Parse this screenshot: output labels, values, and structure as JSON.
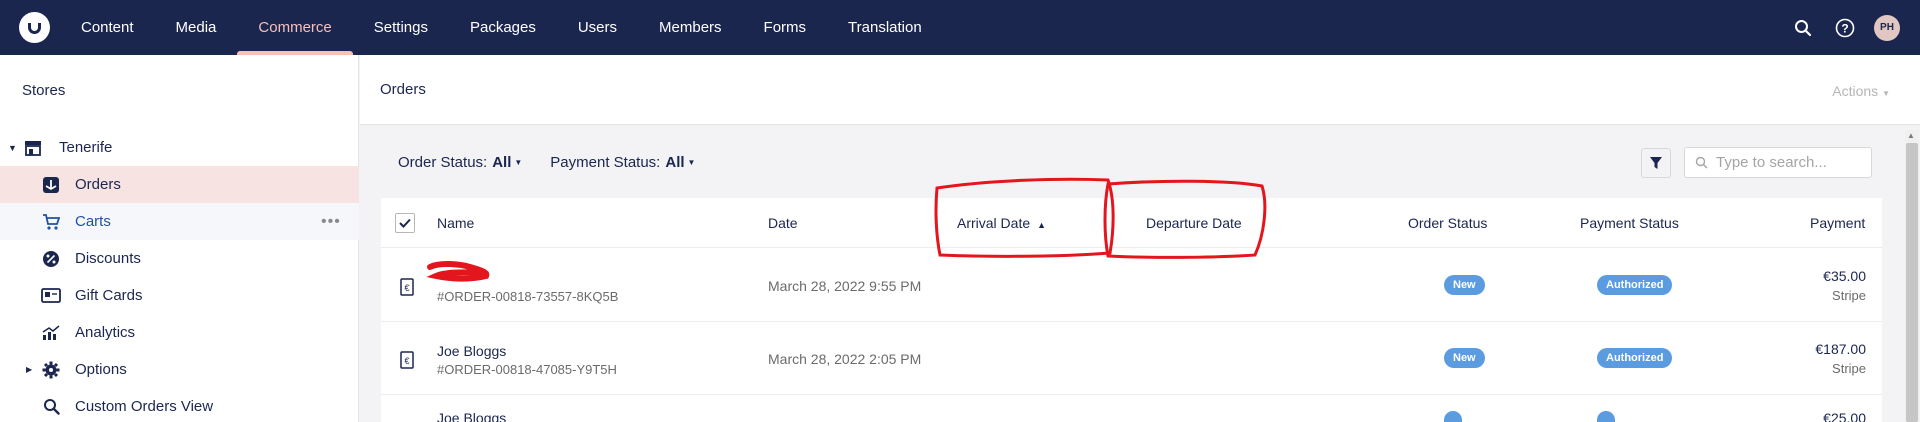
{
  "topbar": {
    "nav": [
      {
        "label": "Content",
        "active": false
      },
      {
        "label": "Media",
        "active": false
      },
      {
        "label": "Commerce",
        "active": true
      },
      {
        "label": "Settings",
        "active": false
      },
      {
        "label": "Packages",
        "active": false
      },
      {
        "label": "Users",
        "active": false
      },
      {
        "label": "Members",
        "active": false
      },
      {
        "label": "Forms",
        "active": false
      },
      {
        "label": "Translation",
        "active": false
      }
    ],
    "user_initials": "PH",
    "icons": [
      "search-icon",
      "help-icon",
      "avatar"
    ]
  },
  "sidebar": {
    "title": "Stores",
    "store": "Tenerife",
    "items": [
      {
        "label": "Orders",
        "icon": "orders-icon",
        "state": "active"
      },
      {
        "label": "Carts",
        "icon": "cart-icon",
        "state": "hover"
      },
      {
        "label": "Discounts",
        "icon": "discount-icon",
        "state": ""
      },
      {
        "label": "Gift Cards",
        "icon": "gift-card-icon",
        "state": ""
      },
      {
        "label": "Analytics",
        "icon": "analytics-icon",
        "state": ""
      },
      {
        "label": "Options",
        "icon": "gear-icon",
        "state": ""
      },
      {
        "label": "Custom Orders View",
        "icon": "search-icon",
        "state": ""
      }
    ],
    "more_label": "•••"
  },
  "main": {
    "title": "Orders",
    "actions_label": "Actions",
    "filters": {
      "order_status_label": "Order Status:",
      "order_status_value": "All",
      "payment_status_label": "Payment Status:",
      "payment_status_value": "All"
    },
    "search_placeholder": "Type to search...",
    "columns": {
      "name": "Name",
      "date": "Date",
      "arrival": "Arrival Date",
      "departure": "Departure Date",
      "order_status": "Order Status",
      "payment_status": "Payment Status",
      "payment": "Payment"
    },
    "rows": [
      {
        "name": "",
        "order": "#ORDER-00818-73557-8KQ5B",
        "date": "March 28, 2022 9:55 PM",
        "order_status": "New",
        "payment_status": "Authorized",
        "amount": "€35.00",
        "gateway": "Stripe"
      },
      {
        "name": "Joe Bloggs",
        "order": "#ORDER-00818-47085-Y9T5H",
        "date": "March 28, 2022 2:05 PM",
        "order_status": "New",
        "payment_status": "Authorized",
        "amount": "€187.00",
        "gateway": "Stripe"
      },
      {
        "name": "Joe Bloggs",
        "order": "",
        "date": "",
        "order_status": "",
        "payment_status": "",
        "amount": "€25.00",
        "gateway": ""
      }
    ]
  },
  "colors": {
    "topbar": "#1b264f",
    "accent": "#f5c1bc",
    "badge": "#5b9be0",
    "annotation": "#e3161d"
  }
}
